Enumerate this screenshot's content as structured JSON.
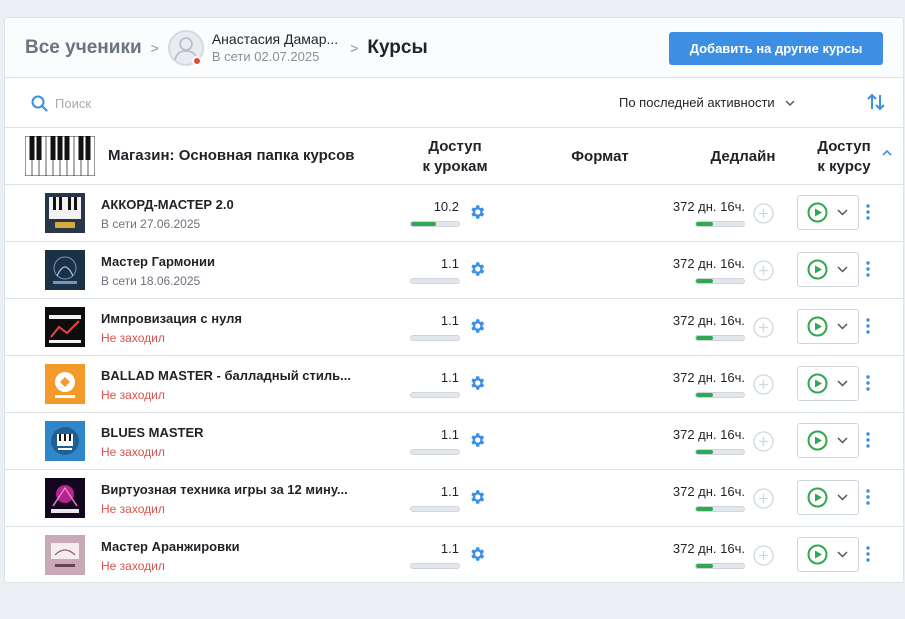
{
  "breadcrumb": {
    "root": "Все ученики",
    "student_name": "Анастасия Дамар...",
    "student_online": "В сети 02.07.2025",
    "current": "Курсы"
  },
  "actions": {
    "add_courses": "Добавить на другие курсы"
  },
  "toolbar": {
    "search_placeholder": "Поиск",
    "sort_label": "По последней активности"
  },
  "table": {
    "folder_title": "Магазин: Основная папка курсов",
    "columns": {
      "lessons_access_1": "Доступ",
      "lessons_access_2": "к урокам",
      "format": "Формат",
      "deadline": "Дедлайн",
      "course_access_1": "Доступ",
      "course_access_2": "к курсу"
    }
  },
  "colors": {
    "accent": "#3d8fe3",
    "progress": "#2fa84f",
    "offline": "#d9534f"
  },
  "courses": [
    {
      "title": "АККОРД-МАСТЕР 2.0",
      "status": "В сети 27.06.2025",
      "never": false,
      "lessons": "10.2",
      "lesson_progress": 0.52,
      "deadline": "372 дн. 16ч.",
      "deadline_progress": 0.35,
      "thumb": "piano-keys"
    },
    {
      "title": "Мастер Гармонии",
      "status": "В сети 18.06.2025",
      "never": false,
      "lessons": "1.1",
      "lesson_progress": 0,
      "deadline": "372 дн. 16ч.",
      "deadline_progress": 0.35,
      "thumb": "harmony"
    },
    {
      "title": "Импровизация с нуля",
      "status": "Не заходил",
      "never": true,
      "lessons": "1.1",
      "lesson_progress": 0,
      "deadline": "372 дн. 16ч.",
      "deadline_progress": 0.35,
      "thumb": "improv"
    },
    {
      "title": "BALLAD MASTER - балладный стиль...",
      "status": "Не заходил",
      "never": true,
      "lessons": "1.1",
      "lesson_progress": 0,
      "deadline": "372 дн. 16ч.",
      "deadline_progress": 0.35,
      "thumb": "ballad"
    },
    {
      "title": "BLUES MASTER",
      "status": "Не заходил",
      "never": true,
      "lessons": "1.1",
      "lesson_progress": 0,
      "deadline": "372 дн. 16ч.",
      "deadline_progress": 0.35,
      "thumb": "blues"
    },
    {
      "title": "Виртуозная техника игры за 12 мину...",
      "status": "Не заходил",
      "never": true,
      "lessons": "1.1",
      "lesson_progress": 0,
      "deadline": "372 дн. 16ч.",
      "deadline_progress": 0.35,
      "thumb": "virtuoso"
    },
    {
      "title": "Мастер Аранжировки",
      "status": "Не заходил",
      "never": true,
      "lessons": "1.1",
      "lesson_progress": 0,
      "deadline": "372 дн. 16ч.",
      "deadline_progress": 0.35,
      "thumb": "arrangement"
    }
  ]
}
